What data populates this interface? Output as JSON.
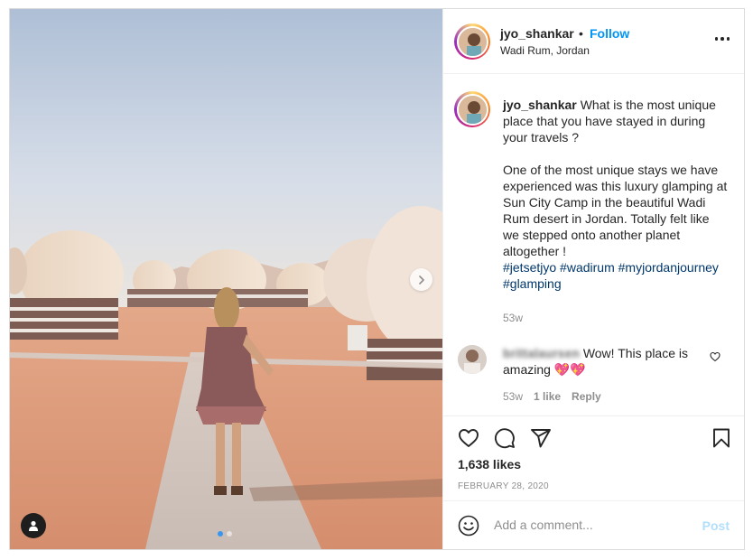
{
  "post": {
    "author": "jyo_shankar",
    "follow_separator": "•",
    "follow_label": "Follow",
    "location": "Wadi Rum, Jordan",
    "more_icon": "more-options-icon",
    "caption": {
      "username": "jyo_shankar",
      "text": "What is the most unique place that you have stayed in during your travels ?\n\nOne of the most unique stays we have experienced was this luxury glamping at Sun City Camp in the beautiful Wadi Rum desert in Jordan. Totally felt like we stepped onto another planet altogether !",
      "hashtags": [
        "#jetsetjyo",
        "#wadirum",
        "#myjordanjourney",
        "#glamping"
      ],
      "time": "53w"
    },
    "comments": [
      {
        "username": "brittalaursen",
        "text": "Wow! This place is amazing 💖💖",
        "time": "53w",
        "likes": "1 like",
        "reply_label": "Reply"
      }
    ],
    "likes": "1,638 likes",
    "date": "FEBRUARY 28, 2020",
    "add_comment": {
      "placeholder": "Add a comment...",
      "post_label": "Post"
    },
    "carousel": {
      "count": 2,
      "active": 0
    }
  },
  "colors": {
    "follow": "#0095f6",
    "hashtag": "#00376b",
    "muted": "#8e8e8e",
    "post_disabled": "#b2dffc",
    "carousel_active": "#3797f0"
  },
  "icons": [
    "more-options-icon",
    "next-arrow-icon",
    "tag-people-icon",
    "heart-icon",
    "comment-icon",
    "share-icon",
    "bookmark-icon",
    "emoji-icon"
  ]
}
